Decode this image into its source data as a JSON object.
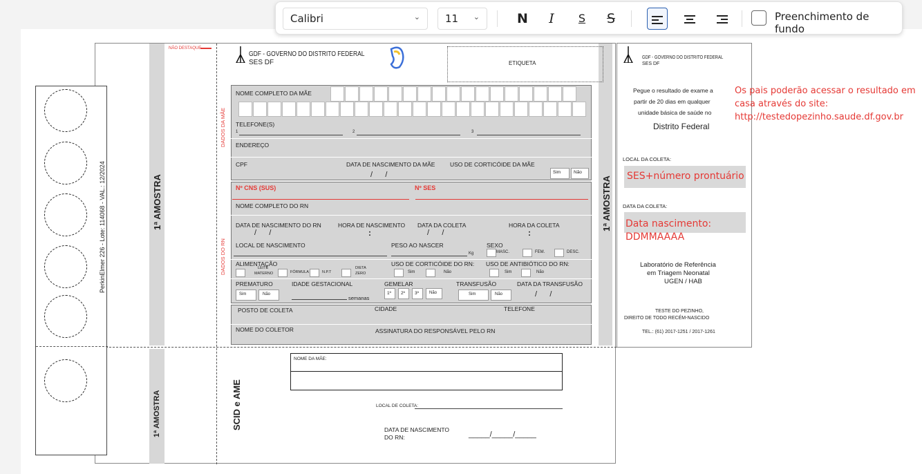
{
  "toolbar": {
    "font_name": "Calibri",
    "font_size": "11",
    "bold": "N",
    "italic": "I",
    "underline": "S",
    "strike": "S",
    "fill_label": "Preenchimento de fundo"
  },
  "card": {
    "lot_text": "PerkinElmer 226 - Lote: 114068 - VAL.: 12/2024"
  },
  "form": {
    "nao_destaque": "NÃO DESTAQUE",
    "gdf_line1": "GDF - GOVERNO DO DISTRITO FEDERAL",
    "gdf_line2": "SES DF",
    "etiqueta": "ETIQUETA",
    "amostra_left": "1ª AMOSTRA",
    "amostra_right": "1ª AMOSTRA",
    "amostra_bottom": "1ª AMOSTRA",
    "dados_mae": "DADOS DA MÃE",
    "dados_rn": "DADOS DO RN",
    "nome_mae": "NOME COMPLETO DA MÃE",
    "telefones": "TELEFONE(S)",
    "tel1": "1",
    "tel2": "2",
    "tel3": "3",
    "endereco": "ENDEREÇO",
    "cpf": "CPF",
    "nasc_mae": "DATA DE NASCIMENTO DA MÃE",
    "corticoide_mae": "USO DE CORTICÓIDE DA MÃE",
    "sim": "Sim",
    "nao": "Não",
    "cns": "Nº CNS (SUS)",
    "ses": "Nº SES",
    "nome_rn": "NOME COMPLETO DO RN",
    "nasc_rn": "DATA DE NASCIMENTO DO RN",
    "hora_nasc": "HORA DE NASCIMENTO",
    "data_coleta": "DATA DA COLETA",
    "hora_coleta": "HORA DA COLETA",
    "local_nasc": "LOCAL DE NASCIMENTO",
    "peso": "PESO AO NASCER",
    "kg": "Kg",
    "sexo": "SEXO",
    "masc": "MASC.",
    "fem": "FEM.",
    "desc": "DESC.",
    "alimentacao": "ALIMENTAÇÃO",
    "leite": "LEITE",
    "materno": "MATERNO",
    "formula": "FÓRMULA",
    "npt": "N.P.T",
    "dieta": "DIETA",
    "zero": "ZERO",
    "corticoide_rn": "USO DE CORTICÓIDE DO RN:",
    "antibiotico_rn": "USO DE ANTIBIÓTICO DO RN:",
    "prematuro": "PREMATURO",
    "idade_gest": "IDADE GESTACIONAL",
    "semanas": "semanas",
    "gemelar": "GEMELAR",
    "g1": "1º",
    "g2": "2º",
    "g3": "3º",
    "transfusao": "TRANSFUSÃO",
    "data_transfusao": "DATA DA TRANSFUSÃO",
    "posto": "POSTO DE COLETA",
    "cidade": "CIDADE",
    "telefone": "TELEFONE",
    "nome_coletor": "NOME DO COLETOR",
    "assinatura": "ASSINATURA DO RESPONSÁVEL PELO RN",
    "scid": "SCID e AME",
    "nome_mae_bottom": "NOME DA MÃE:",
    "local_coleta_bottom": "LOCAL DE COLETA:",
    "nasc_bottom_1": "DATA DE NASCIMENTO",
    "nasc_bottom_2": "DO RN:"
  },
  "right_panel": {
    "gdf_line1": "GDF - GOVERNO DO DISTRITO FEDERAL",
    "gdf_line2": "SES DF",
    "pegue1": "Pegue o resultado de exame a",
    "pegue2": "partir de 20 dias em qualquer",
    "pegue3": "unidade básica de saúde no",
    "df": "Distrito Federal",
    "local_coleta": "LOCAL DA COLETA:",
    "local_value": "SES+número prontuário",
    "data_coleta": "DATA DA COLETA:",
    "data_value1": "Data nascimento:",
    "data_value2": "DDMMAAAA",
    "lab1": "Laboratório de Referência",
    "lab2": "em Triagem Neonatal",
    "lab3": "UGEN / HAB",
    "teste1": "TESTE DO PEZINHO,",
    "teste2": "DIREITO DE TODO RECÉM-NASCIDO",
    "tel": "TEL.: (61) 2017-1251 / 2017-1261"
  },
  "annotation": {
    "line1": "Os pais poderão acessar o resultado em",
    "line2": "casa através do site:",
    "line3": "http://testedopezinho.saude.df.gov.br"
  }
}
